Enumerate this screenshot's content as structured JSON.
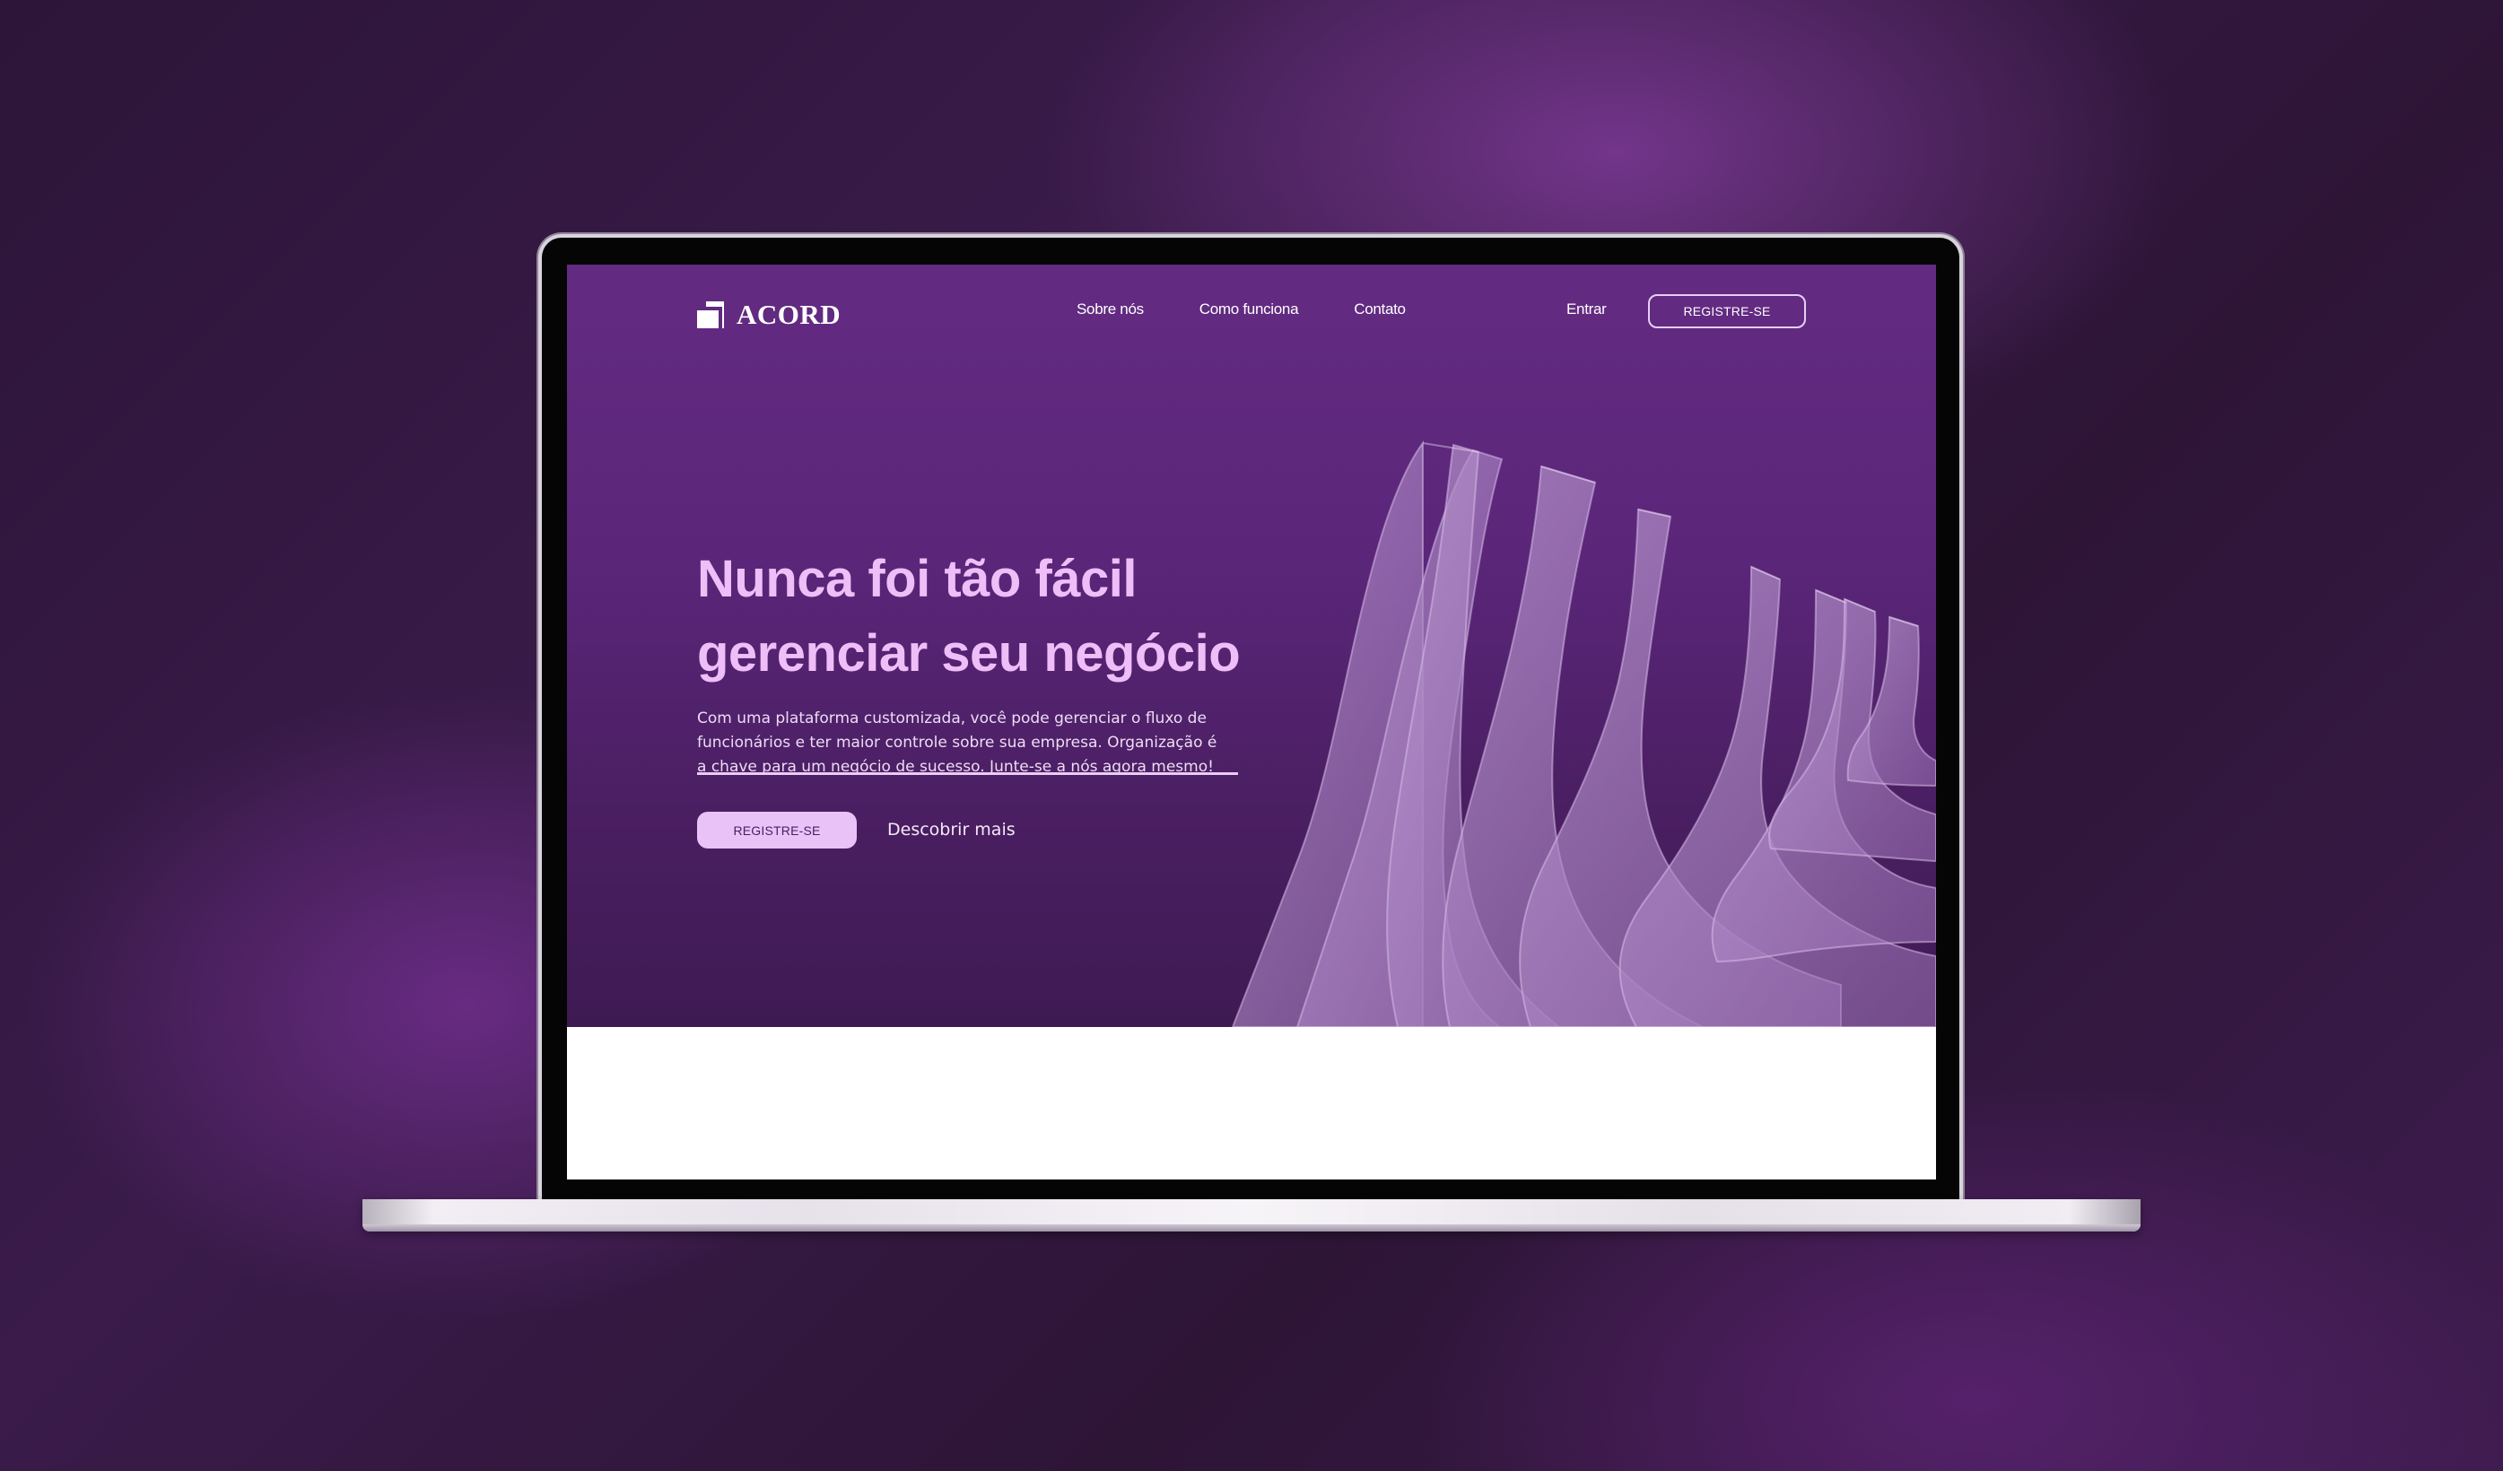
{
  "brand": {
    "name": "ACORD"
  },
  "nav": {
    "links": [
      "Sobre nós",
      "Como funciona",
      "Contato"
    ],
    "login": "Entrar",
    "register": "REGISTRE-SE"
  },
  "hero": {
    "headline": "Nunca foi tão fácil gerenciar seu negócio",
    "description": "Com uma plataforma customizada, você pode gerenciar o fluxo de funcionários e ter maior controle sobre sua empresa. Organização é a chave para um negócio de sucesso. Junte-se a nós agora mesmo!",
    "primary_cta": "REGISTRE-SE",
    "secondary_cta": "Descobrir mais"
  },
  "colors": {
    "background": "#3a1b4a",
    "hero_primary": "#5b267a",
    "headline": "#efbdf7",
    "accent_button": "#e9c3f8",
    "text_light": "#eddcf4"
  },
  "icons": {
    "logo": "acord-logo-icon",
    "hero_art": "wave-lines-illustration"
  }
}
